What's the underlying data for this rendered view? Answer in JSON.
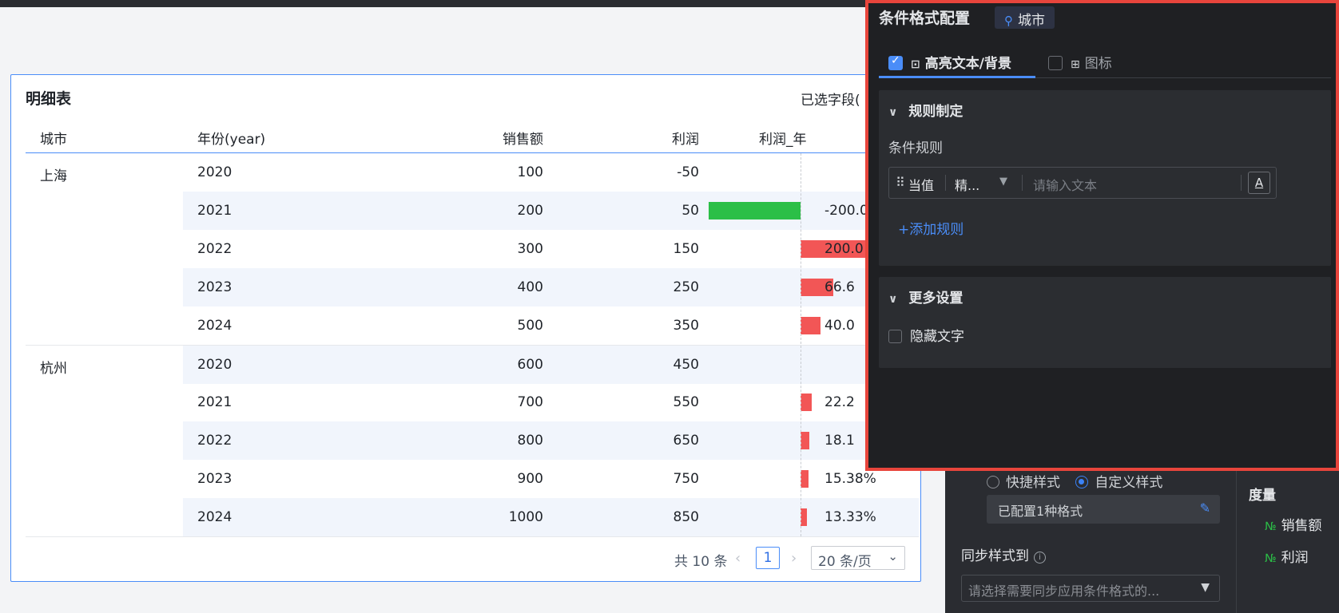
{
  "table": {
    "title": "明细表",
    "selected_fields": "已选字段(",
    "headers": [
      "城市",
      "年份(year)",
      "销售额",
      "利润",
      "利润_年"
    ],
    "rows": [
      {
        "city": "上海",
        "year": "2020",
        "sales": "100",
        "profit": "-50",
        "yoy": "",
        "bar": 0
      },
      {
        "city": "",
        "year": "2021",
        "sales": "200",
        "profit": "50",
        "yoy": "-200.0",
        "bar": -2.0
      },
      {
        "city": "",
        "year": "2022",
        "sales": "300",
        "profit": "150",
        "yoy": "200.0",
        "bar": 2.0
      },
      {
        "city": "",
        "year": "2023",
        "sales": "400",
        "profit": "250",
        "yoy": "66.6",
        "bar": 0.6667
      },
      {
        "city": "",
        "year": "2024",
        "sales": "500",
        "profit": "350",
        "yoy": "40.0",
        "bar": 0.4
      },
      {
        "city": "杭州",
        "year": "2020",
        "sales": "600",
        "profit": "450",
        "yoy": "",
        "bar": 0
      },
      {
        "city": "",
        "year": "2021",
        "sales": "700",
        "profit": "550",
        "yoy": "22.2",
        "bar": 0.2222
      },
      {
        "city": "",
        "year": "2022",
        "sales": "800",
        "profit": "650",
        "yoy": "18.1",
        "bar": 0.1818
      },
      {
        "city": "",
        "year": "2023",
        "sales": "900",
        "profit": "750",
        "yoy": "15.38%",
        "bar": 0.1538
      },
      {
        "city": "",
        "year": "2024",
        "sales": "1000",
        "profit": "850",
        "yoy": "13.33%",
        "bar": 0.1333
      }
    ],
    "colors": {
      "negative_bar": "#2bbf47",
      "positive_bar": "#f25656",
      "accent": "#4a8df8"
    }
  },
  "pagination": {
    "total": "共 10 条",
    "prev_icon": "chevron-left-icon",
    "current_page": "1",
    "next_icon": "chevron-right-icon",
    "page_size": "20 条/页"
  },
  "popup": {
    "title": "条件格式配置",
    "field_tag": "城市",
    "tabs": [
      {
        "label": "高亮文本/背景",
        "checked": true
      },
      {
        "label": "图标",
        "checked": false
      }
    ],
    "rules_section": {
      "title": "规则制定",
      "condition_label": "条件规则",
      "rule": {
        "operand": "当值",
        "operator": "精...",
        "input_placeholder": "请输入文本",
        "style_button": "A"
      },
      "add_rule": "+添加规则"
    },
    "more_section": {
      "title": "更多设置",
      "hide_text": "隐藏文字"
    }
  },
  "side_panel": {
    "style_options": [
      "快捷样式",
      "自定义样式"
    ],
    "configured": "已配置1种格式",
    "sync_label": "同步样式到",
    "sync_placeholder": "请选择需要同步应用条件格式的...",
    "measure_title": "度量",
    "measures": [
      "销售额",
      "利润"
    ]
  }
}
